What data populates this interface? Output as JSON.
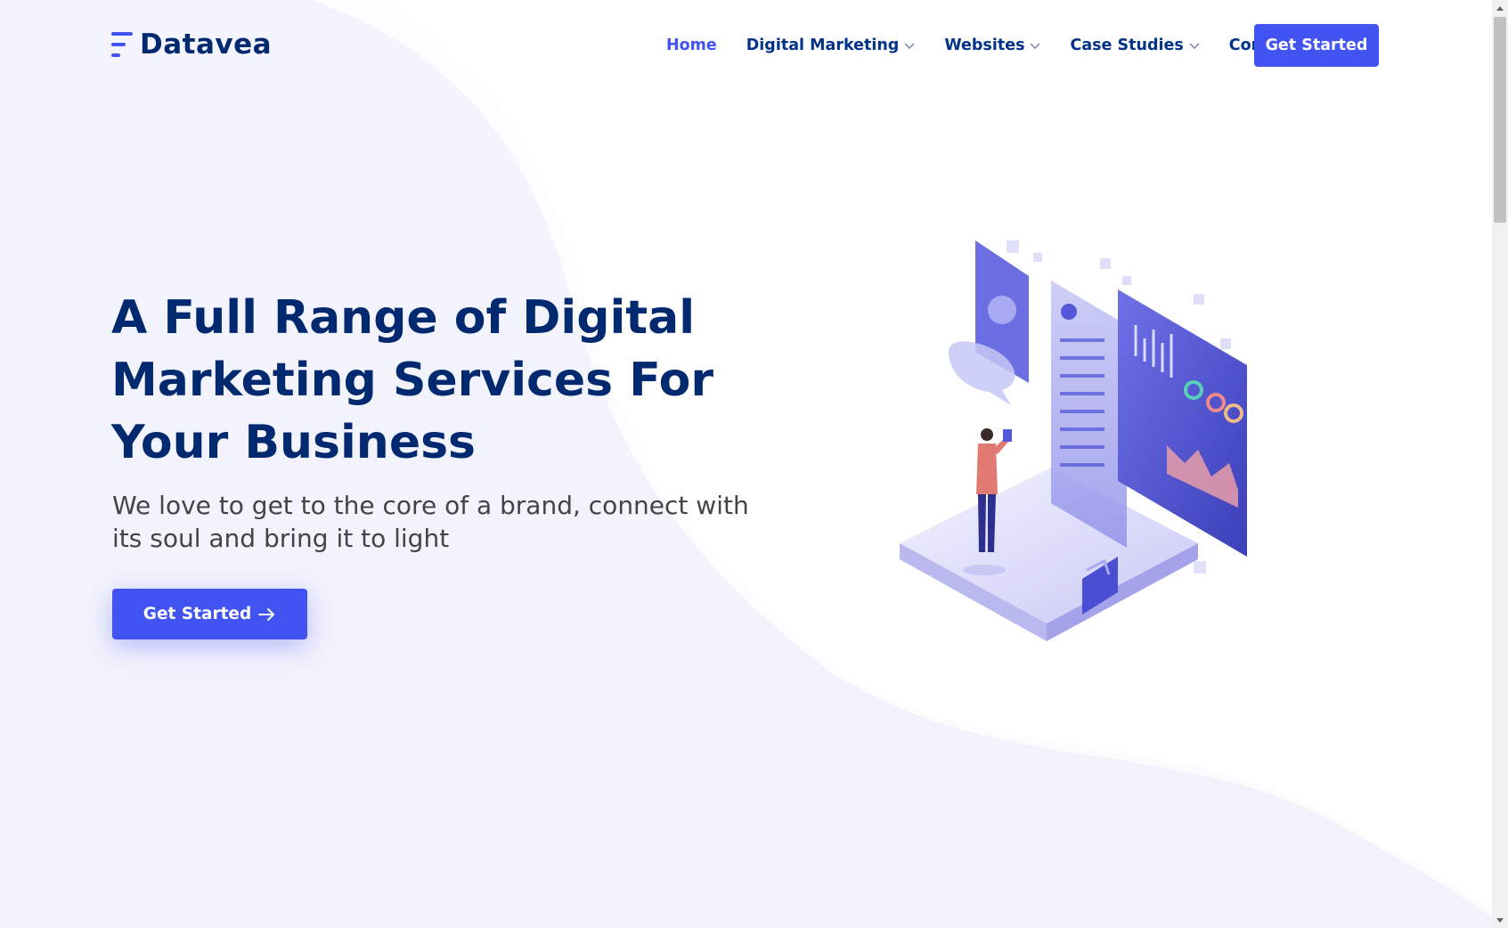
{
  "brand": {
    "name": "Datavea",
    "accent": "#4154f1",
    "dark": "#012970"
  },
  "nav": {
    "items": [
      {
        "label": "Home",
        "active": true,
        "dropdown": false
      },
      {
        "label": "Digital Marketing",
        "active": false,
        "dropdown": true
      },
      {
        "label": "Websites",
        "active": false,
        "dropdown": true
      },
      {
        "label": "Case Studies",
        "active": false,
        "dropdown": true
      },
      {
        "label": "Contact",
        "active": false,
        "dropdown": false
      }
    ],
    "cta_label": "Get Started"
  },
  "hero": {
    "title": "A Full Range of Digital Marketing Services For Your Business",
    "subtitle": "We love to get to the core of a brand, connect with its soul and bring it to light",
    "cta_label": "Get Started",
    "cta_icon": "arrow-right-icon",
    "illustration": "isometric-analytics-dashboard-illustration"
  }
}
